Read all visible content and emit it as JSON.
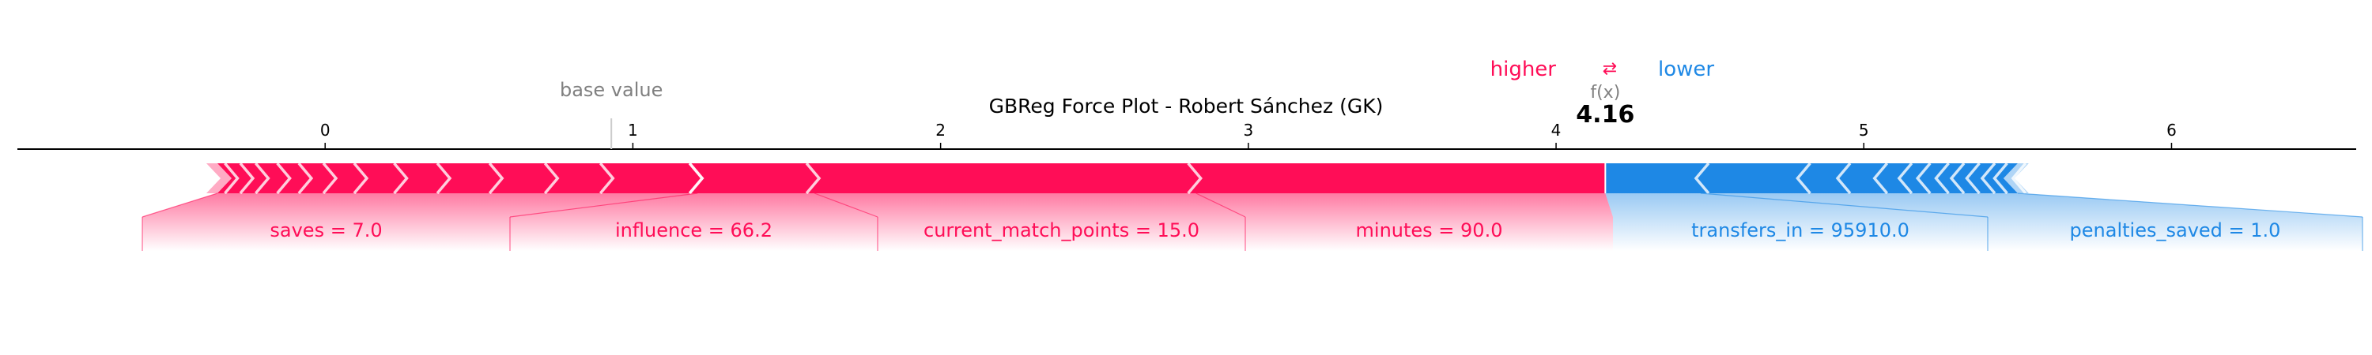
{
  "chart_data": {
    "type": "force",
    "title": "GBReg Force Plot - Robert Sánchez (GK)",
    "base_value": 0.93,
    "base_value_label": "base value",
    "output_value": 4.16,
    "output_value_text": "4.16",
    "output_label": "f(x)",
    "legend": {
      "higher": "higher",
      "lower": "lower",
      "arrows": "⇄"
    },
    "colors": {
      "positive": "#ff0d57",
      "negative": "#1e88e5"
    },
    "xlim": [
      -1.0,
      6.6
    ],
    "ticks": [
      0,
      1,
      2,
      3,
      4,
      5,
      6
    ],
    "tick_labels": [
      "0",
      "1",
      "2",
      "3",
      "4",
      "5",
      "6"
    ],
    "positive_features": [
      {
        "label": "saves = 7.0",
        "start": -0.35,
        "end": 1.21
      },
      {
        "label": "influence = 66.2",
        "start": 1.21,
        "end": 1.59
      },
      {
        "label": "current_match_points = 15.0",
        "start": 1.59,
        "end": 2.83
      },
      {
        "label": "minutes = 90.0",
        "start": 2.83,
        "end": 4.16
      }
    ],
    "negative_features": [
      {
        "label": "transfers_in = 95910.0",
        "start": 4.16,
        "end": 4.47
      },
      {
        "label": "penalties_saved = 1.0",
        "start": 4.47,
        "end": 5.5
      }
    ],
    "positive_small_chevrons": [
      -0.3,
      -0.25,
      -0.2,
      -0.13,
      -0.06,
      0.02,
      0.12,
      0.25,
      0.39,
      0.56,
      0.74,
      0.92
    ],
    "negative_small_chevrons": [
      4.8,
      4.93,
      5.05,
      5.13,
      5.19,
      5.25,
      5.3,
      5.35,
      5.4,
      5.44
    ]
  }
}
